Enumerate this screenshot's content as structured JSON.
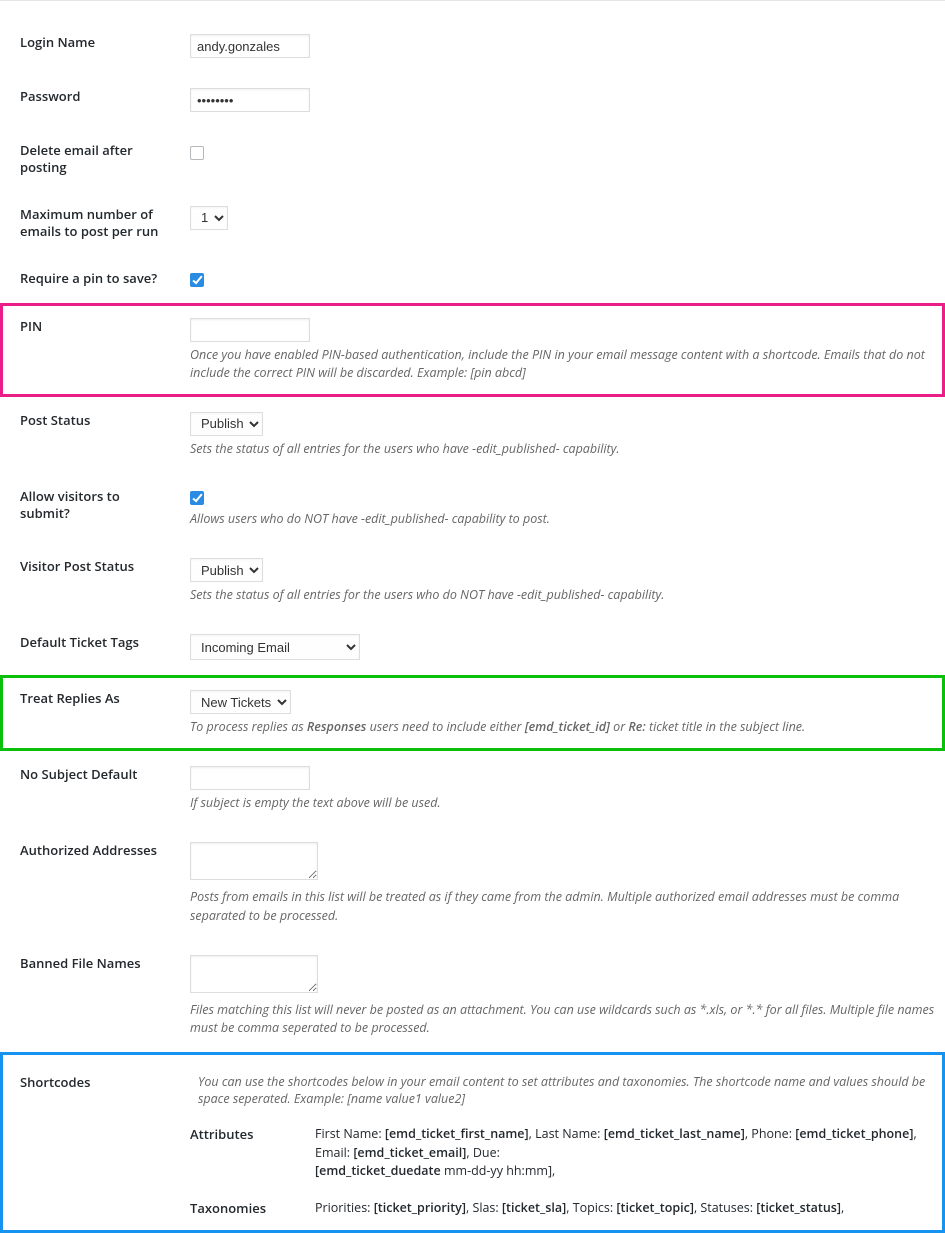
{
  "fields": {
    "login_name": {
      "label": "Login Name",
      "value": "andy.gonzales"
    },
    "password": {
      "label": "Password",
      "value": "••••••••"
    },
    "delete_email": {
      "label": "Delete email after posting"
    },
    "max_emails": {
      "label": "Maximum number of emails to post per run",
      "value": "1"
    },
    "require_pin": {
      "label": "Require a pin to save?"
    },
    "pin": {
      "label": "PIN",
      "desc": "Once you have enabled PIN-based authentication, include the PIN in your email message content with a shortcode. Emails that do not include the correct PIN will be discarded. Example: [pin abcd]"
    },
    "post_status": {
      "label": "Post Status",
      "value": "Publish",
      "desc": "Sets the status of all entries for the users who have -edit_published- capability."
    },
    "allow_visitors": {
      "label": "Allow visitors to submit?",
      "desc": "Allows users who do NOT have -edit_published- capability to post."
    },
    "visitor_post_status": {
      "label": "Visitor Post Status",
      "value": "Publish",
      "desc": "Sets the status of all entries for the users who do NOT have -edit_published- capability."
    },
    "default_tags": {
      "label": "Default Ticket Tags",
      "value": "Incoming Email"
    },
    "treat_replies": {
      "label": "Treat Replies As",
      "value": "New Tickets",
      "desc_pre": "To process replies as ",
      "desc_b1": "Responses",
      "desc_mid": " users need to include either ",
      "desc_b2": "[emd_ticket_id]",
      "desc_mid2": " or ",
      "desc_b3": "Re:",
      "desc_post": " ticket title in the subject line."
    },
    "no_subject": {
      "label": "No Subject Default",
      "desc": "If subject is empty the text above will be used."
    },
    "authorized": {
      "label": "Authorized Addresses",
      "desc": "Posts from emails in this list will be treated as if they came from the admin. Multiple authorized email addresses must be comma separated to be processed."
    },
    "banned": {
      "label": "Banned File Names",
      "desc": "Files matching this list will never be posted as an attachment. You can use wildcards such as *.xls, or *.* for all files. Multiple file names must be comma seperated to be processed."
    }
  },
  "shortcodes": {
    "label": "Shortcodes",
    "intro": "You can use the shortcodes below in your email content to set attributes and taxonomies. The shortcode name and values should be space seperated. Example: [name value1 value2]",
    "attributes": {
      "label": "Attributes",
      "fn_lbl": "First Name: ",
      "fn_tok": "[emd_ticket_first_name]",
      "ln_lbl": ", Last Name: ",
      "ln_tok": "[emd_ticket_last_name]",
      "ph_lbl": ", Phone: ",
      "ph_tok": "[emd_ticket_phone]",
      "em_lbl": ", Email: ",
      "em_tok": "[emd_ticket_email]",
      "du_lbl": ", Due: ",
      "du_line2_tok": "[emd_ticket_duedate",
      "du_line2_post": " mm-dd-yy hh:mm],"
    },
    "taxonomies": {
      "label": "Taxonomies",
      "pr_lbl": "Priorities: ",
      "pr_tok": "[ticket_priority]",
      "sl_lbl": ", Slas: ",
      "sl_tok": "[ticket_sla]",
      "tp_lbl": ", Topics: ",
      "tp_tok": "[ticket_topic]",
      "st_lbl": ", Statuses: ",
      "st_tok": "[ticket_status]",
      "st_post": ","
    }
  }
}
